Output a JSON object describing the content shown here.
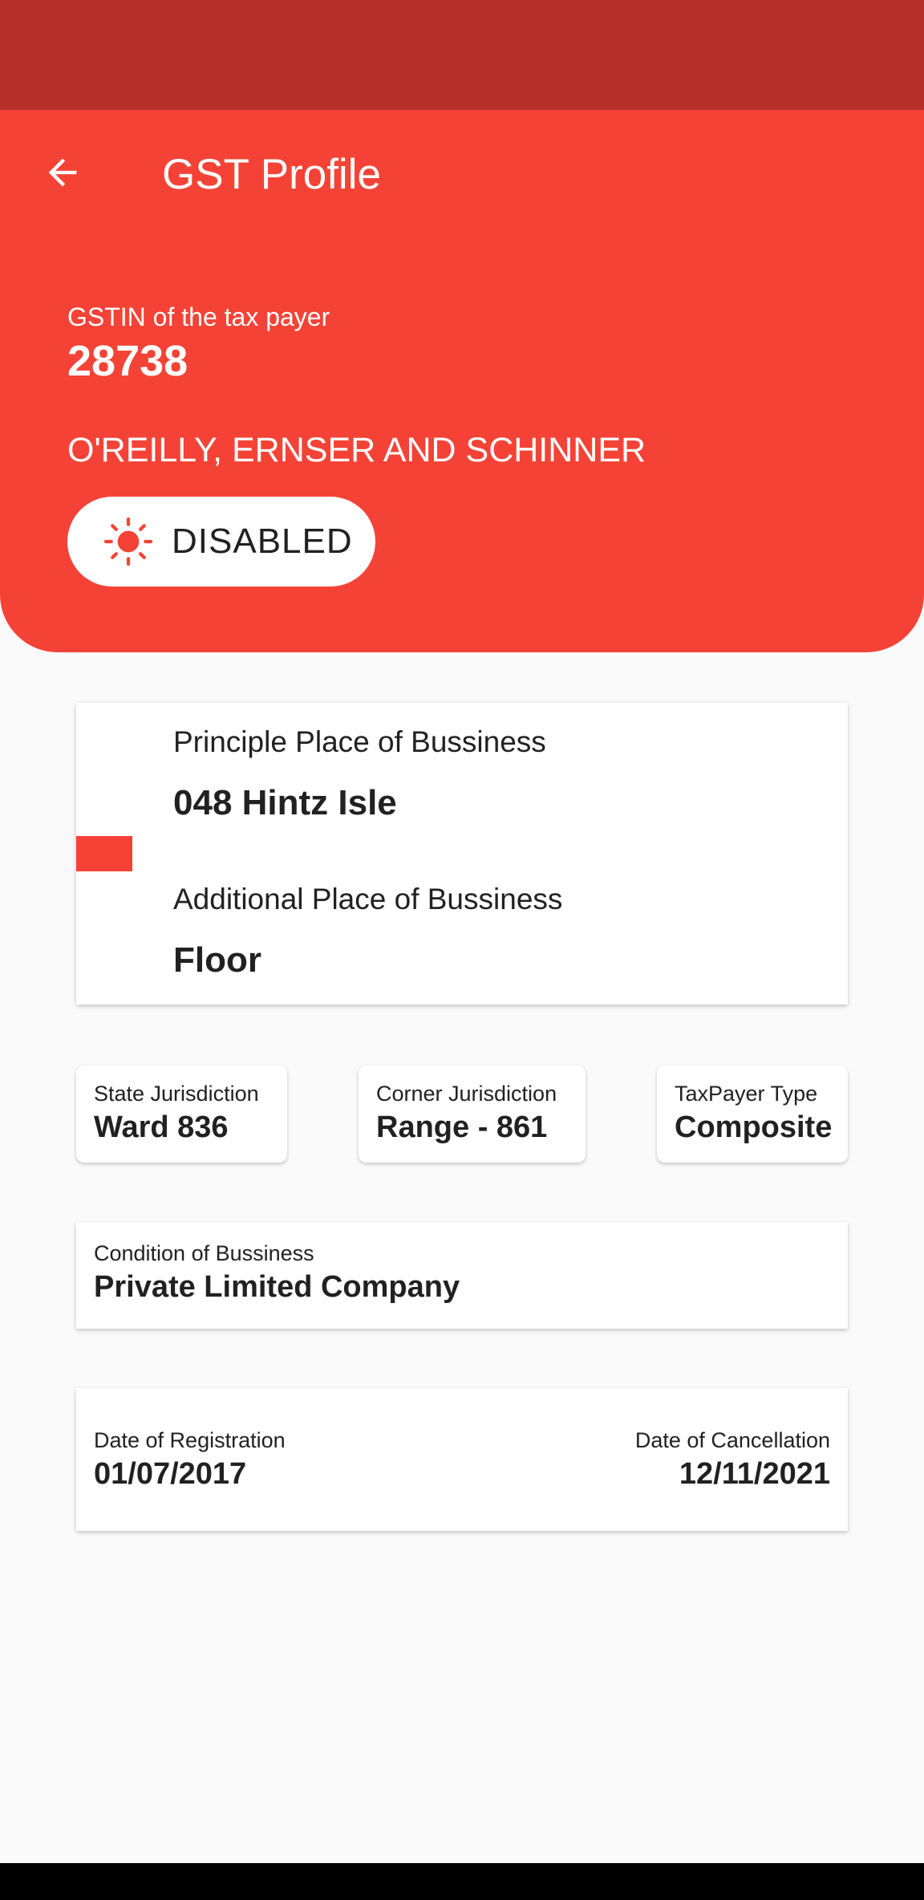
{
  "header": {
    "title": "GST Profile",
    "back_icon": "arrow-back-icon",
    "gstin_label": "GSTIN of the tax payer",
    "gstin_value": "28738",
    "company_name": "O'REILLY, ERNSER AND SCHINNER",
    "status": {
      "label": "DISABLED",
      "icon": "sun-icon"
    }
  },
  "place": {
    "principle_label": "Principle Place of Bussiness",
    "principle_value": "048 Hintz Isle",
    "additional_label": "Additional Place of Bussiness",
    "additional_value": "Floor"
  },
  "jurisdiction": {
    "state_label": "State Jurisdiction",
    "state_value": "Ward 836",
    "corner_label": "Corner Jurisdiction",
    "corner_value": "Range - 861",
    "taxpayer_label": "TaxPayer Type",
    "taxpayer_value": "Composite"
  },
  "condition": {
    "label": "Condition of Bussiness",
    "value": "Private Limited Company"
  },
  "dates": {
    "registration_label": "Date of Registration",
    "registration_value": "01/07/2017",
    "cancellation_label": "Date of Cancellation",
    "cancellation_value": "12/11/2021"
  },
  "colors": {
    "primary": "#f44336",
    "status_bar": "#b7312a",
    "background": "#fafafa"
  }
}
